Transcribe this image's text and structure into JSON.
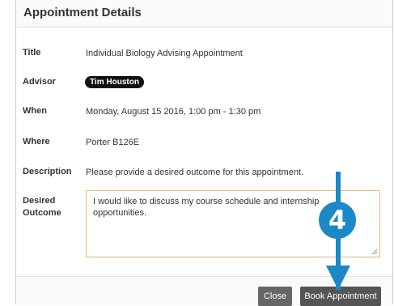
{
  "dialog": {
    "title": "Appointment Details"
  },
  "fields": {
    "title_label": "Title",
    "title_value": "Individual Biology Advising Appointment",
    "advisor_label": "Advisor",
    "advisor_value": "Tim Houston",
    "when_label": "When",
    "when_value": "Monday, August 15 2016, 1:00 pm - 1:30 pm",
    "where_label": "Where",
    "where_value": "Porter B126E",
    "description_label": "Description",
    "description_value": "Please provide a desired outcome for this appointment.",
    "outcome_label_line1": "Desired",
    "outcome_label_line2": "Outcome",
    "outcome_value": "I would like to discuss my course schedule and internship opportunities."
  },
  "footer": {
    "close_label": "Close",
    "book_label": "Book Appointment"
  },
  "callout": {
    "step_number": "4",
    "color": "#1b88c7",
    "arrow_icon": "double-arrow-vertical-icon"
  }
}
